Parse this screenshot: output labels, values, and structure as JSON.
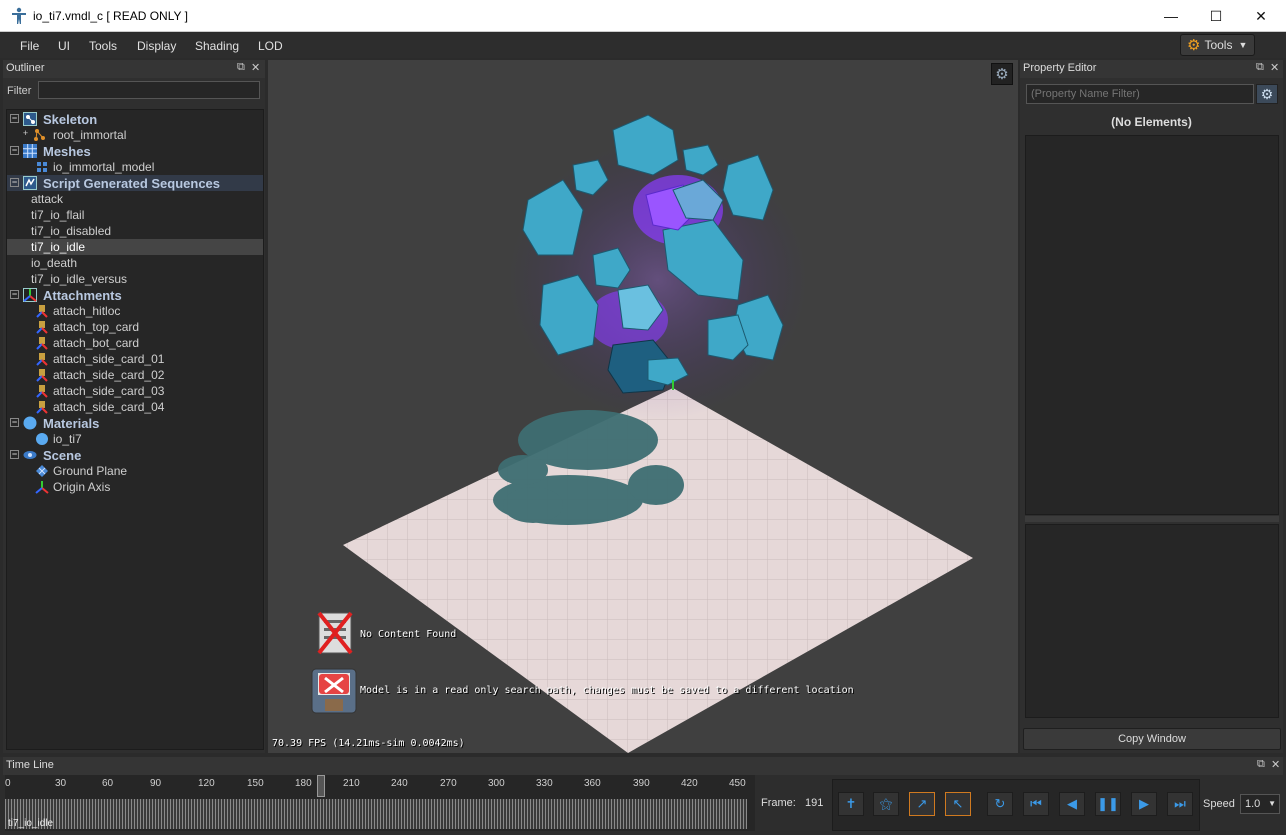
{
  "window": {
    "title": "io_ti7.vmdl_c [ READ ONLY ]"
  },
  "menu": [
    "File",
    "UI",
    "Tools",
    "Display",
    "Shading",
    "LOD"
  ],
  "tools_button": "Tools",
  "outliner": {
    "title": "Outliner",
    "filter_label": "Filter",
    "filter_value": "",
    "sections": {
      "skeleton": {
        "label": "Skeleton",
        "items": [
          "root_immortal"
        ]
      },
      "meshes": {
        "label": "Meshes",
        "items": [
          "io_immortal_model"
        ]
      },
      "sequences": {
        "label": "Script Generated Sequences",
        "items": [
          "attack",
          "ti7_io_flail",
          "ti7_io_disabled",
          "ti7_io_idle",
          "io_death",
          "ti7_io_idle_versus"
        ],
        "selected": "ti7_io_idle"
      },
      "attachments": {
        "label": "Attachments",
        "items": [
          "attach_hitloc",
          "attach_top_card",
          "attach_bot_card",
          "attach_side_card_01",
          "attach_side_card_02",
          "attach_side_card_03",
          "attach_side_card_04"
        ]
      },
      "materials": {
        "label": "Materials",
        "items": [
          "io_ti7"
        ]
      },
      "scene": {
        "label": "Scene",
        "items": [
          "Ground Plane",
          "Origin Axis"
        ]
      }
    }
  },
  "viewport": {
    "message_no_content": "No Content Found",
    "message_read_only": "Model is in a read only search path, changes must be saved to a different location",
    "fps": "70.39 FPS (14.21ms-sim 0.0042ms)"
  },
  "property_editor": {
    "title": "Property Editor",
    "filter_placeholder": "(Property Name Filter)",
    "empty_label": "(No Elements)",
    "copy_button": "Copy Window"
  },
  "timeline": {
    "title": "Time Line",
    "ticks": [
      "0",
      "30",
      "60",
      "90",
      "120",
      "150",
      "180",
      "210",
      "240",
      "270",
      "300",
      "330",
      "360",
      "390",
      "420",
      "450"
    ],
    "current_animation": "ti7_io_idle",
    "frame_label": "Frame:",
    "frame_value": "191",
    "speed_label": "Speed",
    "speed_value": "1.0"
  },
  "colors": {
    "accent_blue": "#3b9ae8",
    "highlight_orange": "#d07a20",
    "crystal": "#3fa8c8",
    "glow": "#8a3cff"
  }
}
